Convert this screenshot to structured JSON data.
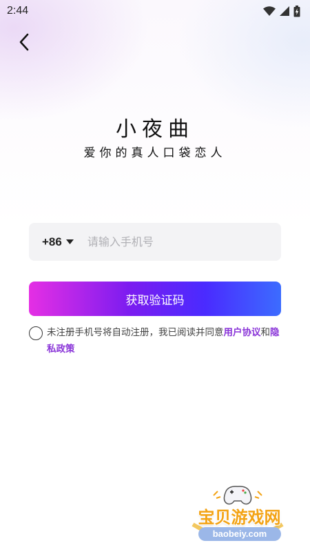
{
  "status_bar": {
    "time": "2:44"
  },
  "header": {
    "title": "小夜曲",
    "subtitle": "爱你的真人口袋恋人"
  },
  "phone": {
    "country_code": "+86",
    "placeholder": "请输入手机号",
    "value": ""
  },
  "code_button": {
    "label": "获取验证码"
  },
  "agreement": {
    "text": "未注册手机号将自动注册，我已阅读并同意",
    "user_agreement": "用户协议",
    "and": "和",
    "privacy_policy": "隐私政策"
  },
  "watermark": {
    "text": "宝贝游戏网",
    "url": "baobeiy.com"
  },
  "colors": {
    "accent": "#8a35d8",
    "gradient_start": "#e52fe4",
    "gradient_end": "#3c6cff",
    "watermark": "#f3a315"
  },
  "icons": [
    "back-icon",
    "wifi-icon",
    "signal-icon",
    "battery-icon",
    "dropdown-icon",
    "radio-icon",
    "gamepad-icon"
  ]
}
